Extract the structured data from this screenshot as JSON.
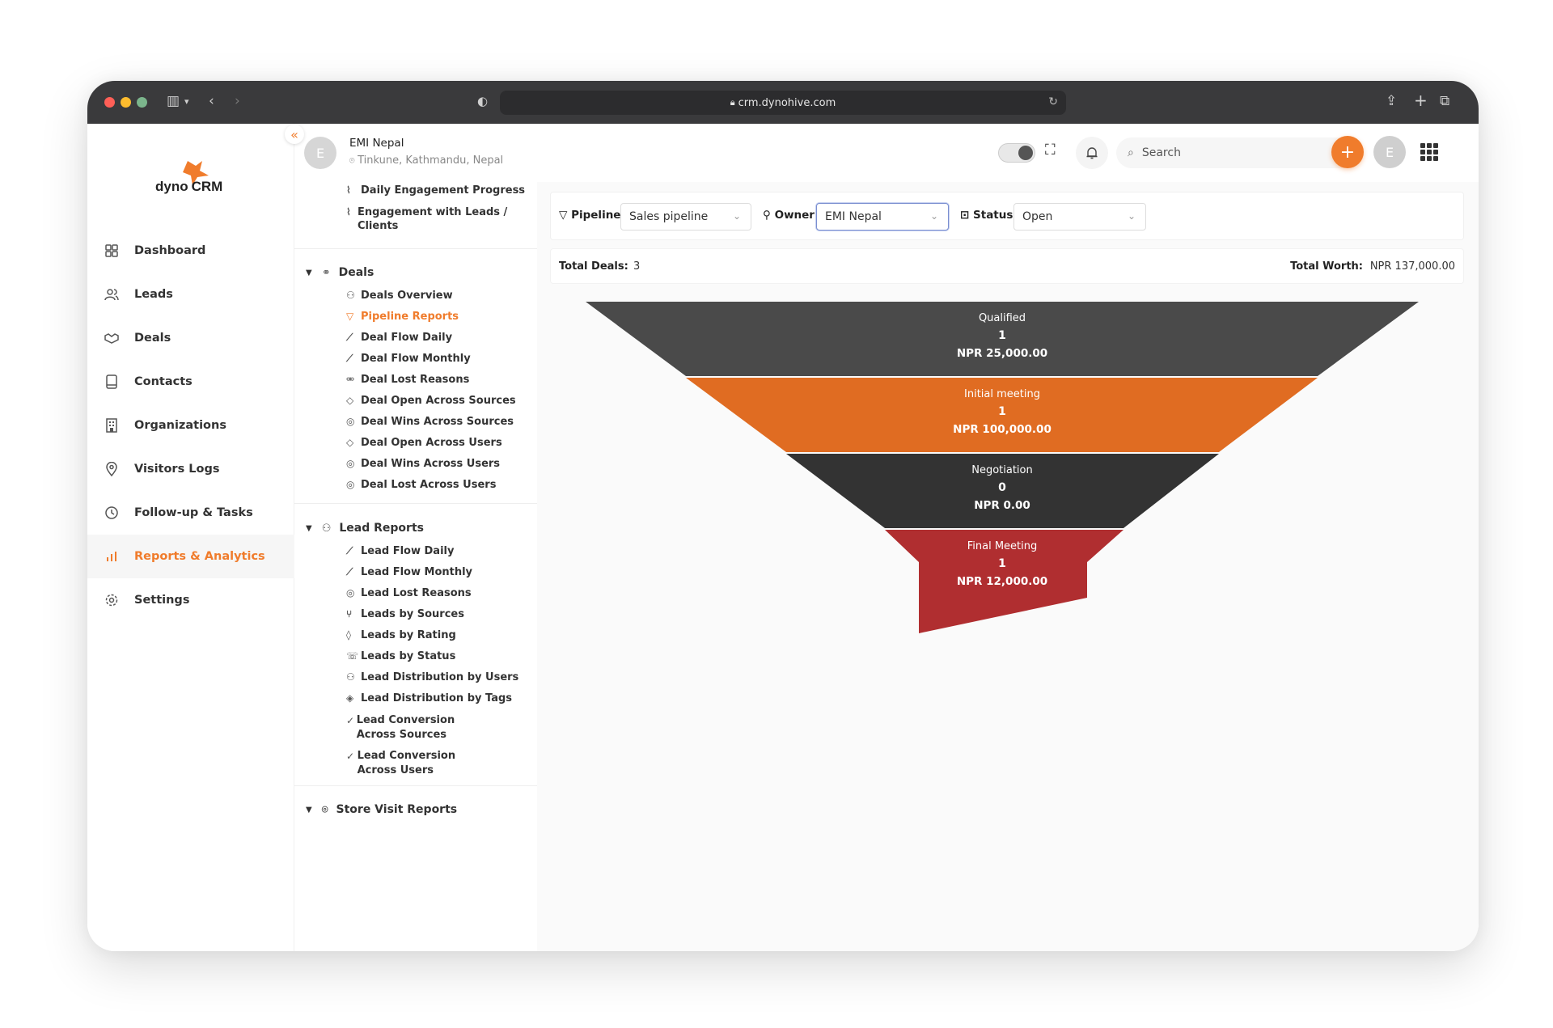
{
  "browser": {
    "url": "crm.dynohive.com"
  },
  "brand": {
    "logo_left": "dyno",
    "logo_right": "CRM",
    "accent": "#f07c2c"
  },
  "sidebar": {
    "items": [
      {
        "label": "Dashboard",
        "icon": "dashboard-icon"
      },
      {
        "label": "Leads",
        "icon": "users-icon"
      },
      {
        "label": "Deals",
        "icon": "handshake-icon"
      },
      {
        "label": "Contacts",
        "icon": "contact-book-icon"
      },
      {
        "label": "Organizations",
        "icon": "building-icon"
      },
      {
        "label": "Visitors Logs",
        "icon": "location-pin-icon"
      },
      {
        "label": "Follow-up & Tasks",
        "icon": "clock-icon"
      },
      {
        "label": "Reports & Analytics",
        "icon": "bar-chart-icon",
        "active": true
      },
      {
        "label": "Settings",
        "icon": "gear-icon"
      }
    ]
  },
  "header": {
    "avatar_initial": "E",
    "org_name": "EMI Nepal",
    "org_location": "Tinkune, Kathmandu, Nepal",
    "search_placeholder": "Search",
    "user_initial": "E"
  },
  "reports_menu": {
    "top_items": [
      "Daily Engagement Progress",
      "Engagement with Leads / Clients"
    ],
    "deals_section": {
      "title": "Deals",
      "items": [
        "Deals Overview",
        "Pipeline Reports",
        "Deal Flow Daily",
        "Deal Flow Monthly",
        "Deal Lost Reasons",
        "Deal Open Across Sources",
        "Deal Wins Across Sources",
        "Deal Open Across Users",
        "Deal Wins Across Users",
        "Deal Lost Across Users"
      ]
    },
    "lead_section": {
      "title": "Lead Reports",
      "items": [
        "Lead Flow Daily",
        "Lead Flow Monthly",
        "Lead Lost Reasons",
        "Leads by Sources",
        "Leads by Rating",
        "Leads by Status",
        "Lead Distribution by Users",
        "Lead Distribution by Tags",
        "Lead Conversion Across Sources",
        "Lead Conversion Across Users"
      ]
    },
    "store_section": {
      "title": "Store Visit Reports"
    }
  },
  "filters": {
    "pipeline_label": "Pipeline:",
    "pipeline_value": "Sales pipeline",
    "owner_label": "Owner:",
    "owner_value": "EMI Nepal",
    "status_label": "Status:",
    "status_value": "Open"
  },
  "totals": {
    "deals_label": "Total Deals:",
    "deals_value": "3",
    "worth_label": "Total Worth:",
    "worth_value": "NPR 137,000.00"
  },
  "funnel": [
    {
      "stage": "Qualified",
      "count": "1",
      "amount": "NPR 25,000.00",
      "color": "#4a4a4a"
    },
    {
      "stage": "Initial meeting",
      "count": "1",
      "amount": "NPR 100,000.00",
      "color": "#e06c22"
    },
    {
      "stage": "Negotiation",
      "count": "0",
      "amount": "NPR 0.00",
      "color": "#333333"
    },
    {
      "stage": "Final Meeting",
      "count": "1",
      "amount": "NPR 12,000.00",
      "color": "#b02e30"
    }
  ]
}
